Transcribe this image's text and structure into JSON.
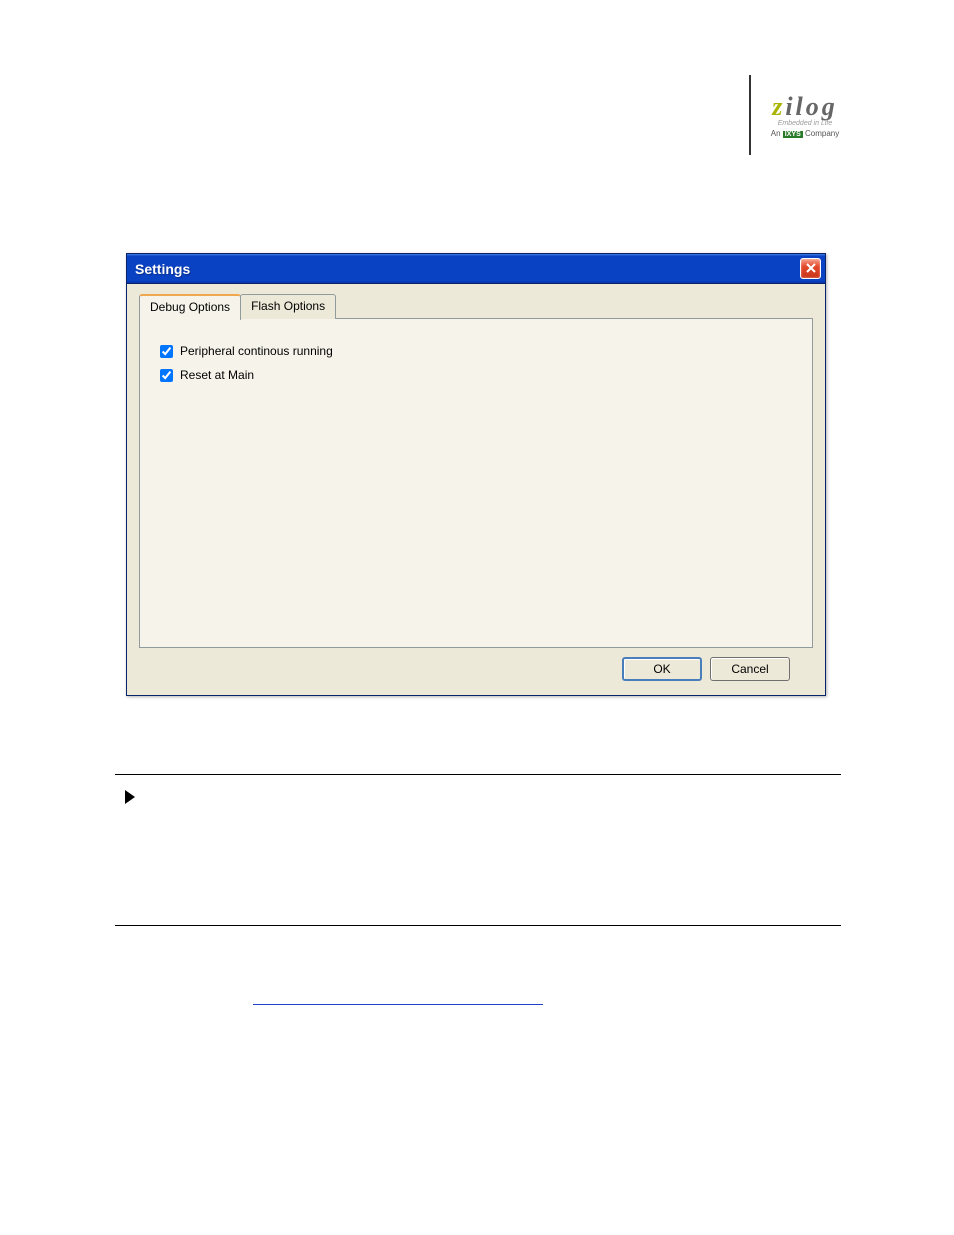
{
  "logo": {
    "brand_z": "z",
    "brand_rest": "ilog",
    "tagline1": "Embedded in Life",
    "tagline2_pre": "An ",
    "tagline2_box": "IXYS",
    "tagline2_post": " Company"
  },
  "dialog": {
    "title": "Settings",
    "tabs": {
      "debug": "Debug Options",
      "flash": "Flash Options"
    },
    "checkboxes": {
      "peripheral": "Peripheral continous running",
      "reset": "Reset at Main"
    },
    "buttons": {
      "ok": "OK",
      "cancel": "Cancel"
    }
  }
}
